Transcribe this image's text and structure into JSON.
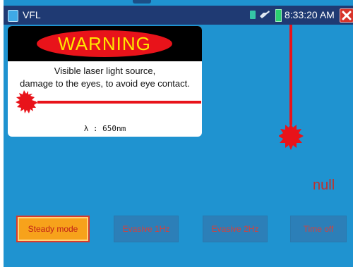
{
  "titlebar": {
    "app_title": "VFL",
    "clock": "8:33:20 AM",
    "icons": [
      "sim-card-icon",
      "usb-icon",
      "battery-icon",
      "close-icon"
    ]
  },
  "warning": {
    "title": "WARNING",
    "line1": "Visible laser light source,",
    "line2": "damage to the eyes, to avoid eye contact.",
    "wavelength": "λ : 650nm"
  },
  "status": {
    "value": "null"
  },
  "modes": [
    {
      "label": "Steady mode",
      "active": true
    },
    {
      "label": "Evasive 1Hz",
      "active": false
    },
    {
      "label": "Evasive 2Hz",
      "active": false
    },
    {
      "label": "Time off",
      "active": false
    }
  ],
  "colors": {
    "background": "#1f93d0",
    "statusbar": "#1f3a73",
    "laser_red": "#e8131a",
    "warning_yellow": "#ffe700",
    "active_button": "#f7a21b"
  }
}
